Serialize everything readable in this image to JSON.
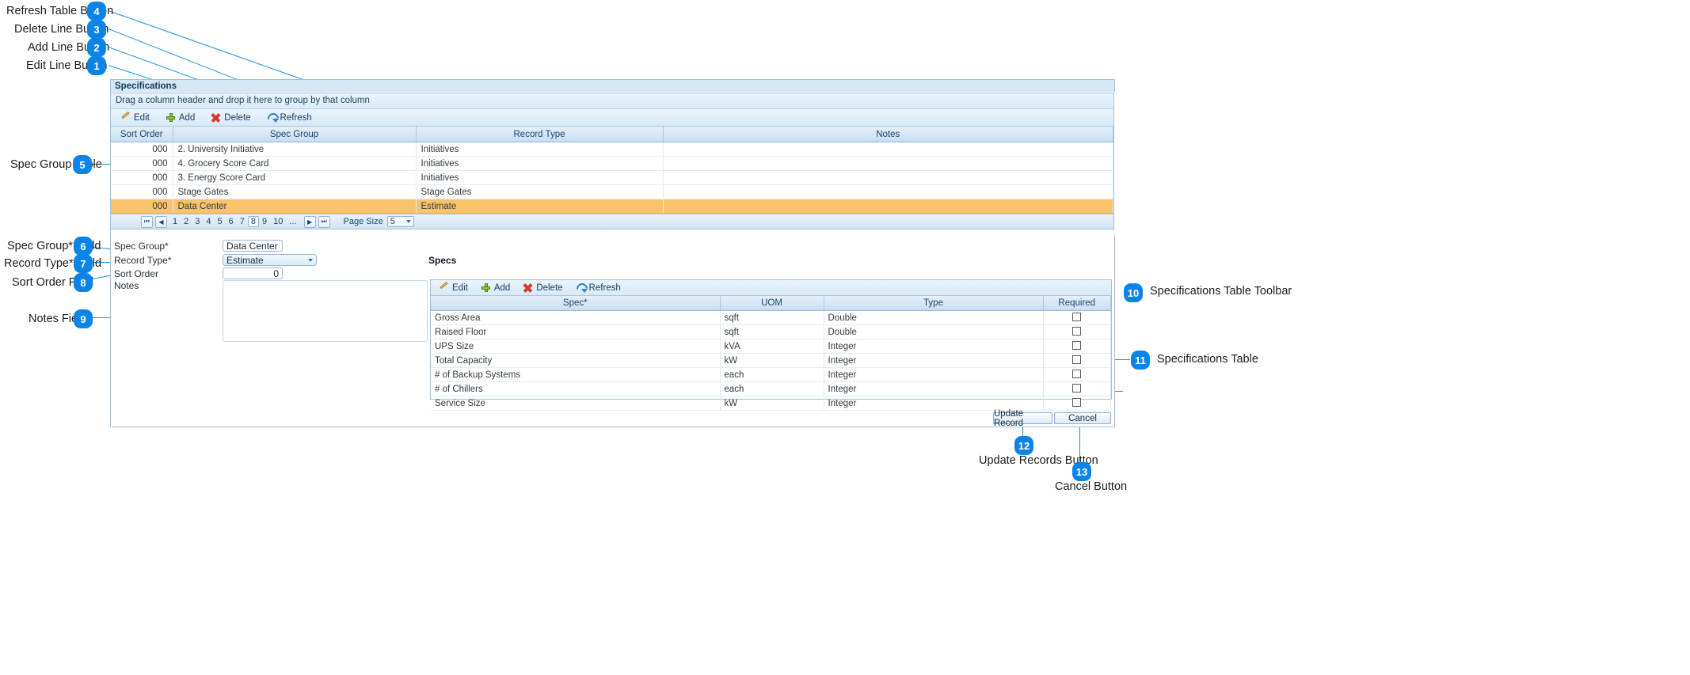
{
  "panel": {
    "title": "Specifications",
    "group_hint": "Drag a column header and drop it here to group by that column"
  },
  "toolbar": {
    "edit": "Edit",
    "add": "Add",
    "delete": "Delete",
    "refresh": "Refresh"
  },
  "spec_group_table": {
    "columns": [
      "Sort Order",
      "Spec Group",
      "Record Type",
      "Notes"
    ],
    "rows": [
      {
        "sort_order": "000",
        "spec_group": "2. University Initiative",
        "record_type": "Initiatives",
        "notes": "",
        "selected": false
      },
      {
        "sort_order": "000",
        "spec_group": "4. Grocery Score Card",
        "record_type": "Initiatives",
        "notes": "",
        "selected": false
      },
      {
        "sort_order": "000",
        "spec_group": "3. Energy Score Card",
        "record_type": "Initiatives",
        "notes": "",
        "selected": false
      },
      {
        "sort_order": "000",
        "spec_group": "Stage Gates",
        "record_type": "Stage Gates",
        "notes": "",
        "selected": false
      },
      {
        "sort_order": "000",
        "spec_group": "Data Center",
        "record_type": "Estimate",
        "notes": "",
        "selected": true
      }
    ]
  },
  "pager": {
    "first_icon": "first-page-icon",
    "prev_icon": "previous-page-icon",
    "next_icon": "next-page-icon",
    "last_icon": "last-page-icon",
    "pages": [
      "1",
      "2",
      "3",
      "4",
      "5",
      "6",
      "7",
      "8",
      "9",
      "10",
      "..."
    ],
    "active_page": "8",
    "page_size_label": "Page Size",
    "page_size_value": "5"
  },
  "form": {
    "spec_group_label": "Spec Group*",
    "spec_group_value": "Data Center",
    "record_type_label": "Record Type*",
    "record_type_value": "Estimate",
    "sort_order_label": "Sort Order",
    "sort_order_value": "0",
    "notes_label": "Notes",
    "notes_value": ""
  },
  "specs": {
    "title": "Specs",
    "columns": [
      "Spec*",
      "UOM",
      "Type",
      "Required"
    ],
    "rows": [
      {
        "spec": "Gross Area",
        "uom": "sqft",
        "type": "Double",
        "required": false
      },
      {
        "spec": "Raised Floor",
        "uom": "sqft",
        "type": "Double",
        "required": false
      },
      {
        "spec": "UPS Size",
        "uom": "kVA",
        "type": "Integer",
        "required": false
      },
      {
        "spec": "Total Capacity",
        "uom": "kW",
        "type": "Integer",
        "required": false
      },
      {
        "spec": "# of Backup Systems",
        "uom": "each",
        "type": "Integer",
        "required": false
      },
      {
        "spec": "# of Chillers",
        "uom": "each",
        "type": "Integer",
        "required": false
      },
      {
        "spec": "Service Size",
        "uom": "kW",
        "type": "Integer",
        "required": false
      }
    ]
  },
  "actions": {
    "update_record": "Update Record",
    "cancel": "Cancel"
  },
  "annotations": {
    "badge_color": "#0a84e8",
    "leader_color": "#1f8fe0",
    "items": [
      {
        "number": "4",
        "label": "Refresh Table Button"
      },
      {
        "number": "3",
        "label": "Delete Line Button"
      },
      {
        "number": "2",
        "label": "Add Line Button"
      },
      {
        "number": "1",
        "label": "Edit Line Button"
      },
      {
        "number": "5",
        "label": "Spec Group Table"
      },
      {
        "number": "6",
        "label": "Spec Group* Field"
      },
      {
        "number": "7",
        "label": "Record Type* Field"
      },
      {
        "number": "8",
        "label": "Sort Order Field"
      },
      {
        "number": "9",
        "label": "Notes Field"
      },
      {
        "number": "10",
        "label": "Specifications Table Toolbar"
      },
      {
        "number": "11",
        "label": "Specifications Table"
      },
      {
        "number": "12",
        "label": "Update Records Button"
      },
      {
        "number": "13",
        "label": "Cancel Button"
      }
    ]
  }
}
